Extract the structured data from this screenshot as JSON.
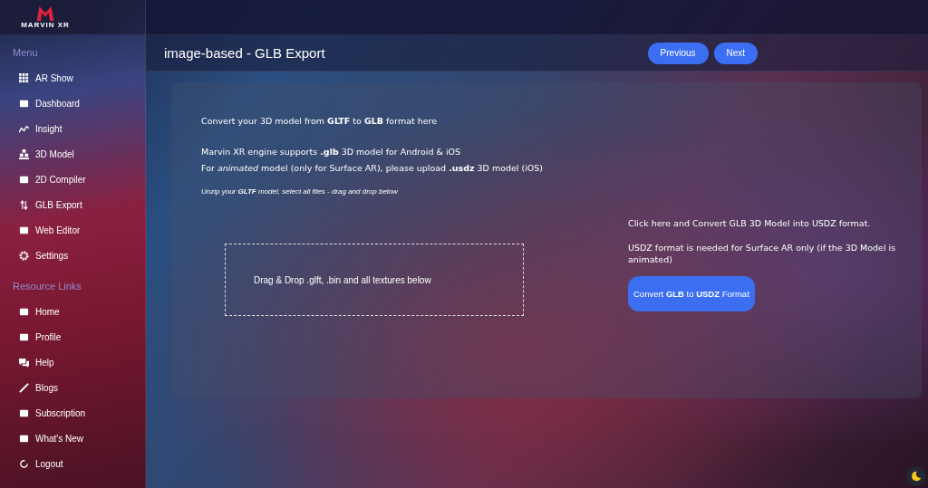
{
  "logo": {
    "text": "MARVIN XR"
  },
  "sidebar": {
    "sections": [
      {
        "heading": "Menu",
        "items": [
          "AR Show",
          "Dashboard",
          "Insight",
          "3D Model",
          "2D Compiler",
          "GLB Export",
          "Web Editor",
          "Settings"
        ]
      },
      {
        "heading": "Resource Links",
        "items": [
          "Home",
          "Profile",
          "Help",
          "Blogs",
          "Subscription",
          "What's New",
          "Logout"
        ]
      }
    ]
  },
  "page": {
    "title": "image-based - GLB Export",
    "buttons": [
      "Previous",
      "Next"
    ]
  },
  "card": {
    "intro": "Convert your 3D model from **GLTF** to **GLB** format here",
    "lines": [
      "Marvin XR engine supports **.glb** 3D model for Android & iOS",
      "For *animated* model (only for Surface AR), please upload **.usdz** 3D model (iOS)"
    ],
    "hint": "Unzip your **GLTF** model, select all files - drag and drop below",
    "dropzone": "Drag & Drop .glft, .bin and all textures below",
    "usdz_note": "Click here and Convert GLB 3D Model into USDZ format.",
    "usdz_need": "USDZ format is needed for Surface AR only (if the 3D Model is animated)",
    "convert_button": "Convert **GLB** to **USDZ** Format"
  }
}
